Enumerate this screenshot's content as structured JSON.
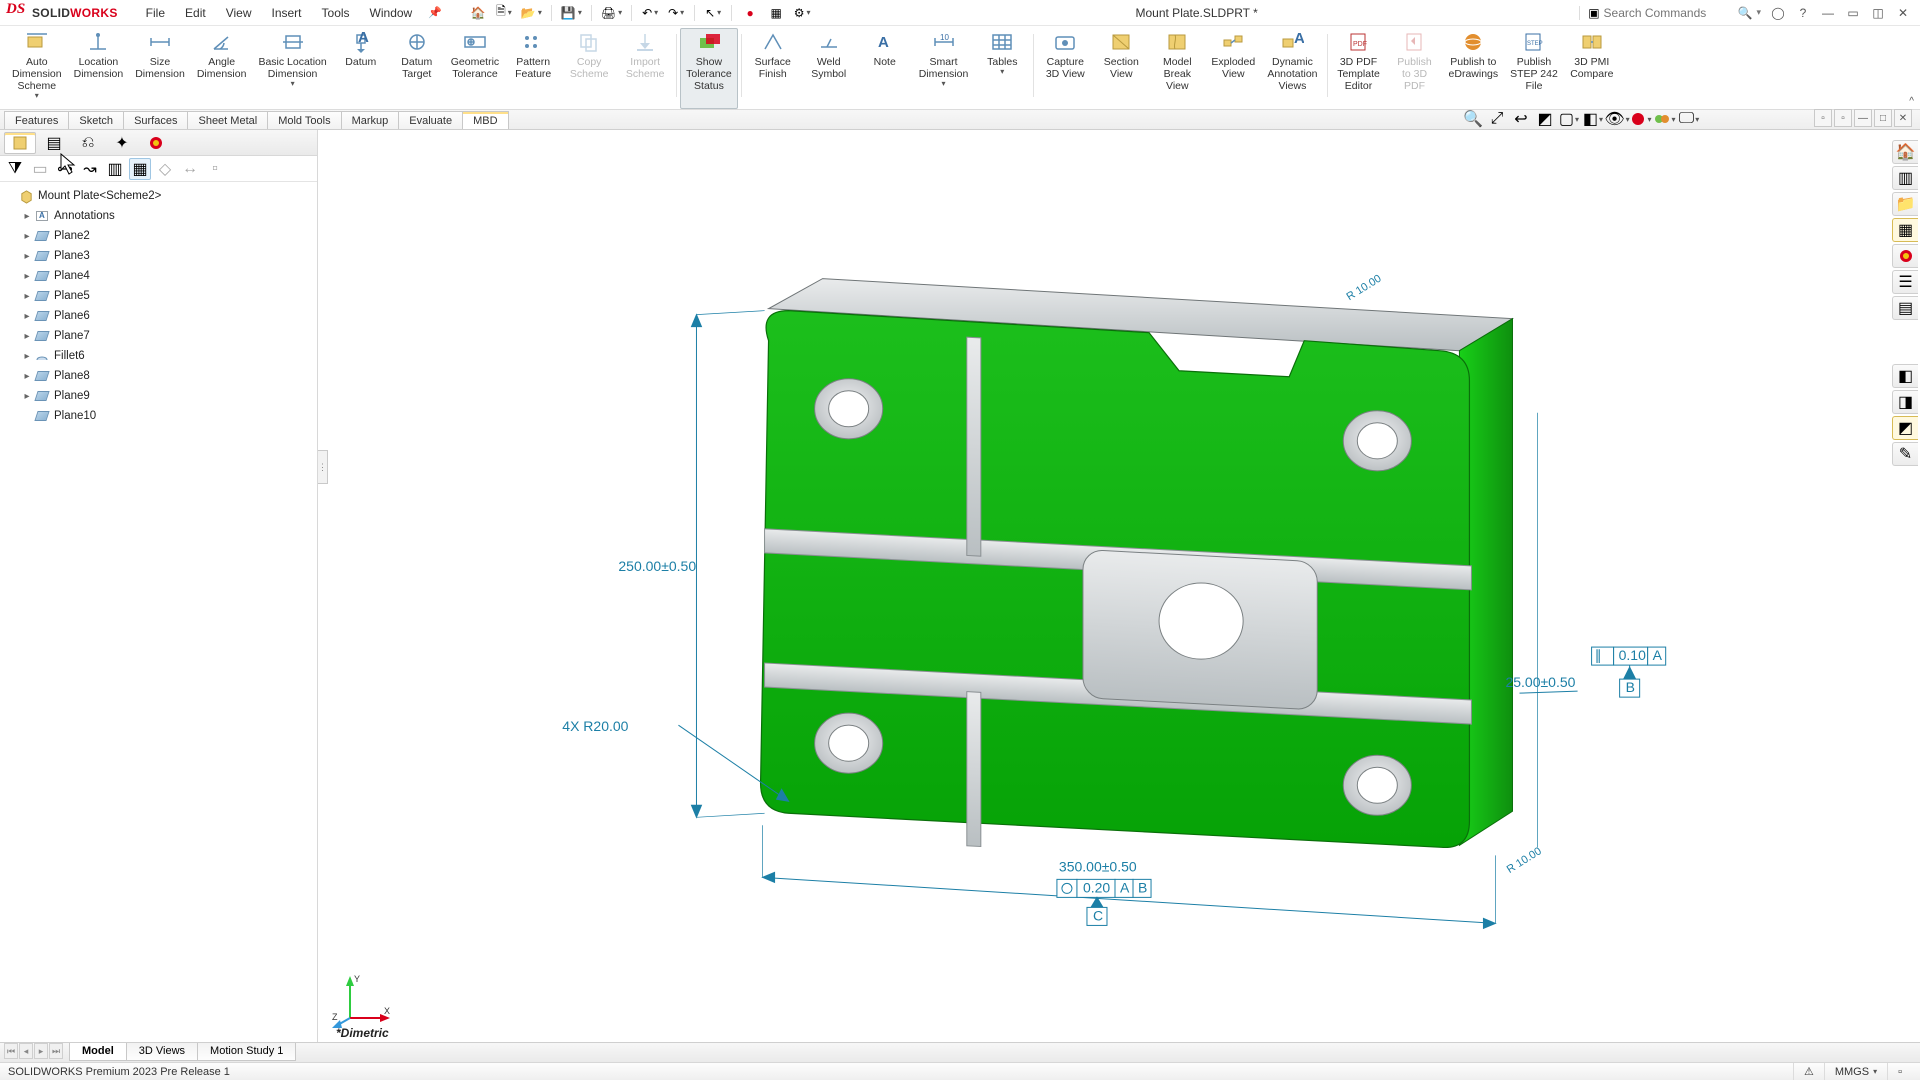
{
  "app": {
    "brand_solid": "SOLID",
    "brand_works": "WORKS",
    "doc_title": "Mount Plate.SLDPRT *"
  },
  "menu": [
    "File",
    "Edit",
    "View",
    "Insert",
    "Tools",
    "Window"
  ],
  "search": {
    "placeholder": "Search Commands"
  },
  "ribbon": [
    {
      "id": "auto-dim",
      "label": "Auto\nDimension\nScheme",
      "drop": true
    },
    {
      "id": "loc-dim",
      "label": "Location\nDimension"
    },
    {
      "id": "size-dim",
      "label": "Size\nDimension"
    },
    {
      "id": "ang-dim",
      "label": "Angle\nDimension"
    },
    {
      "id": "bloc-dim",
      "label": "Basic Location\nDimension",
      "drop": true
    },
    {
      "id": "datum",
      "label": "Datum"
    },
    {
      "id": "dtarget",
      "label": "Datum\nTarget"
    },
    {
      "id": "gtol",
      "label": "Geometric\nTolerance"
    },
    {
      "id": "pfeat",
      "label": "Pattern\nFeature"
    },
    {
      "id": "cscheme",
      "label": "Copy\nScheme",
      "disabled": true
    },
    {
      "id": "ischeme",
      "label": "Import\nScheme",
      "disabled": true
    },
    {
      "id": "showtol",
      "label": "Show\nTolerance\nStatus",
      "active": true
    },
    {
      "id": "sfin",
      "label": "Surface\nFinish"
    },
    {
      "id": "weld",
      "label": "Weld\nSymbol"
    },
    {
      "id": "note",
      "label": "Note"
    },
    {
      "id": "smartd",
      "label": "Smart\nDimension",
      "drop": true
    },
    {
      "id": "tables",
      "label": "Tables",
      "drop": true
    },
    {
      "id": "cap3d",
      "label": "Capture\n3D View"
    },
    {
      "id": "secview",
      "label": "Section\nView"
    },
    {
      "id": "mbreak",
      "label": "Model\nBreak\nView"
    },
    {
      "id": "explode",
      "label": "Exploded\nView"
    },
    {
      "id": "dynann",
      "label": "Dynamic\nAnnotation\nViews"
    },
    {
      "id": "3dpdft",
      "label": "3D PDF\nTemplate\nEditor"
    },
    {
      "id": "pub3dpdf",
      "label": "Publish\nto 3D\nPDF",
      "disabled": true
    },
    {
      "id": "pubedr",
      "label": "Publish to\neDrawings"
    },
    {
      "id": "pubstep",
      "label": "Publish\nSTEP 242\nFile"
    },
    {
      "id": "pmicmp",
      "label": "3D PMI\nCompare"
    }
  ],
  "cmtabs": [
    "Features",
    "Sketch",
    "Surfaces",
    "Sheet Metal",
    "Mold Tools",
    "Markup",
    "Evaluate",
    "MBD"
  ],
  "cmtab_active": 7,
  "tree": {
    "root": "Mount Plate<Scheme2>",
    "items": [
      {
        "t": "ann",
        "label": "Annotations",
        "exp": true
      },
      {
        "t": "plane",
        "label": "Plane2",
        "exp": true
      },
      {
        "t": "plane",
        "label": "Plane3",
        "exp": true
      },
      {
        "t": "plane",
        "label": "Plane4",
        "exp": true
      },
      {
        "t": "plane",
        "label": "Plane5",
        "exp": true
      },
      {
        "t": "plane",
        "label": "Plane6",
        "exp": true
      },
      {
        "t": "plane",
        "label": "Plane7",
        "exp": true
      },
      {
        "t": "fillet",
        "label": "Fillet6",
        "exp": true
      },
      {
        "t": "plane",
        "label": "Plane8",
        "exp": true
      },
      {
        "t": "plane",
        "label": "Plane9",
        "exp": true
      },
      {
        "t": "plane",
        "label": "Plane10",
        "exp": false
      }
    ]
  },
  "annotations": {
    "height": "250.00±0.50",
    "radius": "4X R20.00",
    "width": "350.00±0.50",
    "width_fcf": "0.20",
    "width_d1": "A",
    "width_d2": "B",
    "width_tert": "C",
    "depth": "25.00±0.50",
    "par_fcf": "0.10",
    "par_d": "A",
    "par_tert": "B",
    "edge1": "R 10.00",
    "edge2": "R 10.00"
  },
  "viewtabs": [
    "Model",
    "3D Views",
    "Motion Study 1"
  ],
  "viewtab_active": 0,
  "viewlabel": "*Dimetric",
  "status": {
    "left": "SOLIDWORKS Premium 2023 Pre Release 1",
    "units": "MMGS"
  }
}
